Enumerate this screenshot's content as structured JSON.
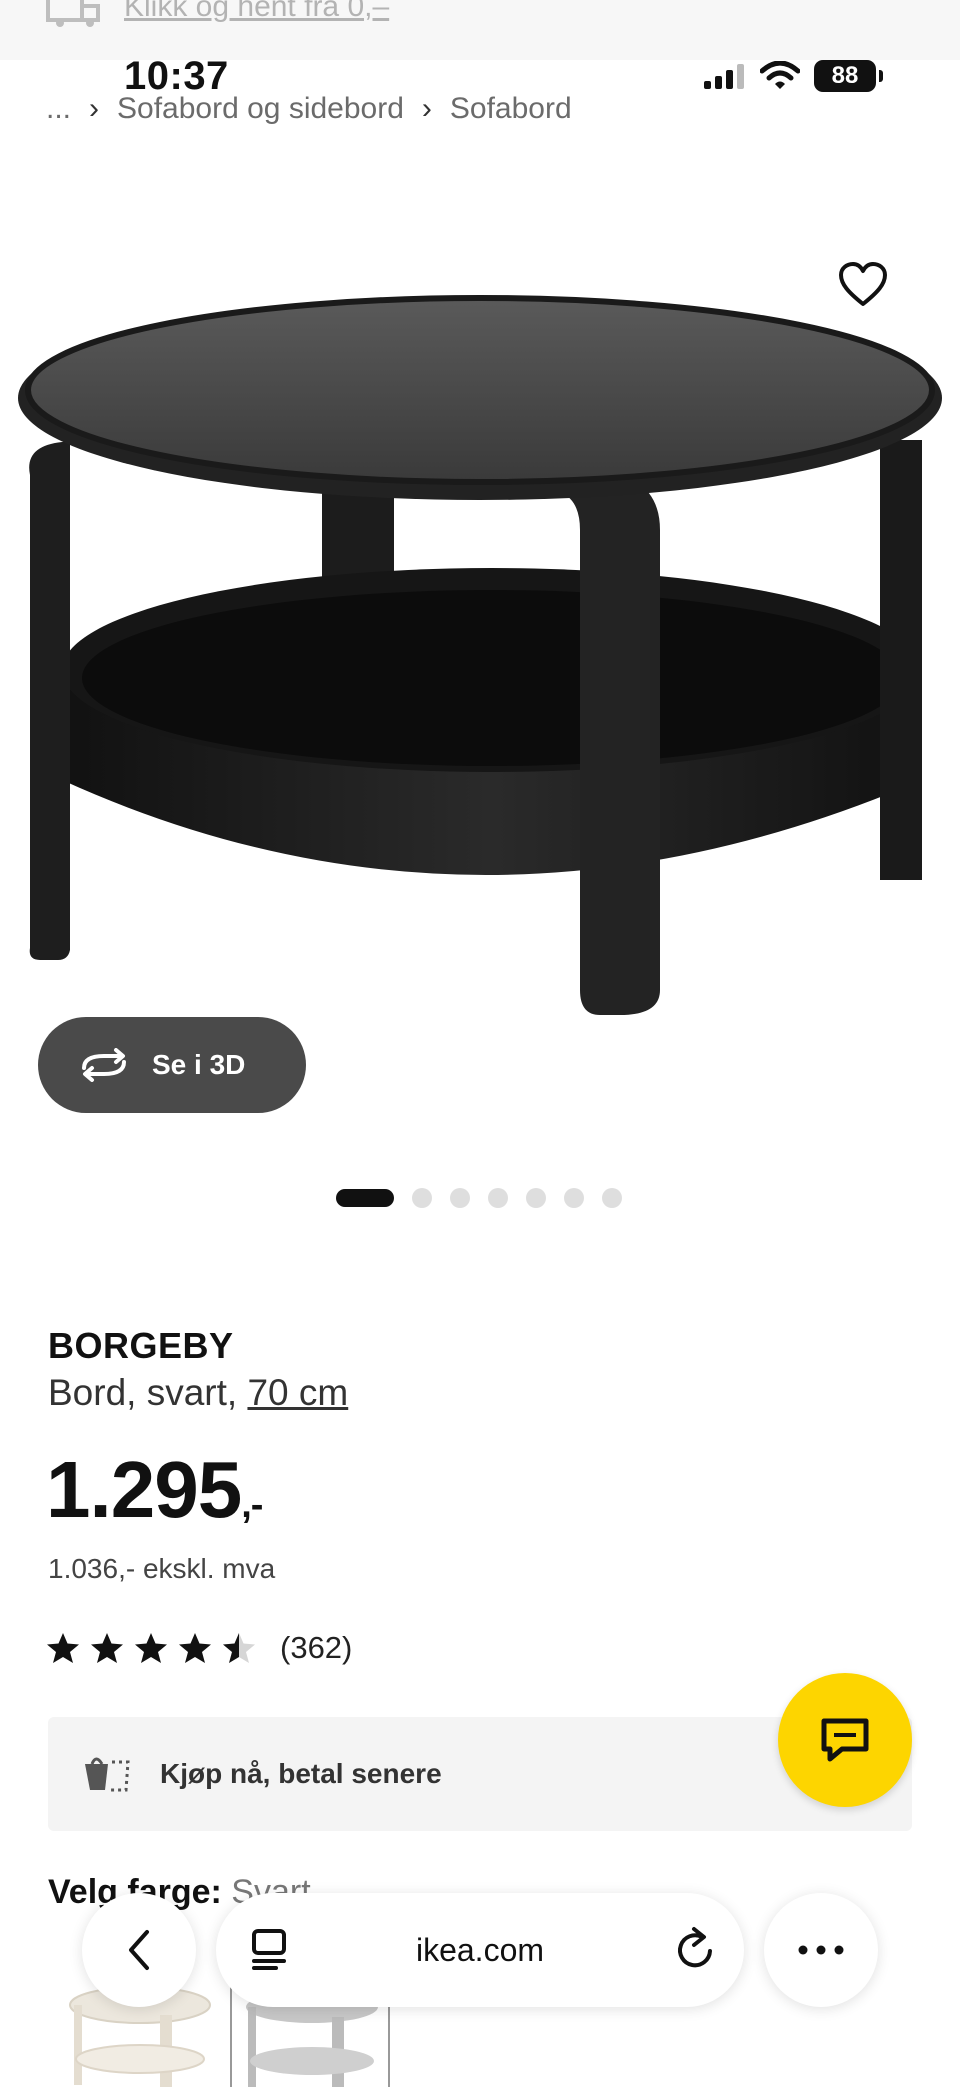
{
  "banner": {
    "text": "Klikk og hent fra 0,–"
  },
  "status_bar": {
    "time": "10:37",
    "battery": "88"
  },
  "breadcrumb": {
    "ellipsis": "...",
    "items": [
      "Sofabord og sidebord",
      "Sofabord"
    ]
  },
  "see_3d": {
    "label": "Se i 3D"
  },
  "carousel": {
    "total": 7,
    "active": 1
  },
  "product": {
    "name": "BORGEBY",
    "desc_prefix": "Bord, svart, ",
    "size": "70 cm",
    "price": "1.295",
    "price_suffix": ",-",
    "price_ex": "1.036,- ekskl. mva",
    "rating": 4.5,
    "rating_count": "(362)"
  },
  "klarna": {
    "label": "Kjøp nå, betal senere"
  },
  "color": {
    "label": "Velg farge:",
    "value": "Svart"
  },
  "browser": {
    "url": "ikea.com"
  },
  "colors": {
    "accent": "#fdd500",
    "dark_button": "#4a4a4a"
  }
}
